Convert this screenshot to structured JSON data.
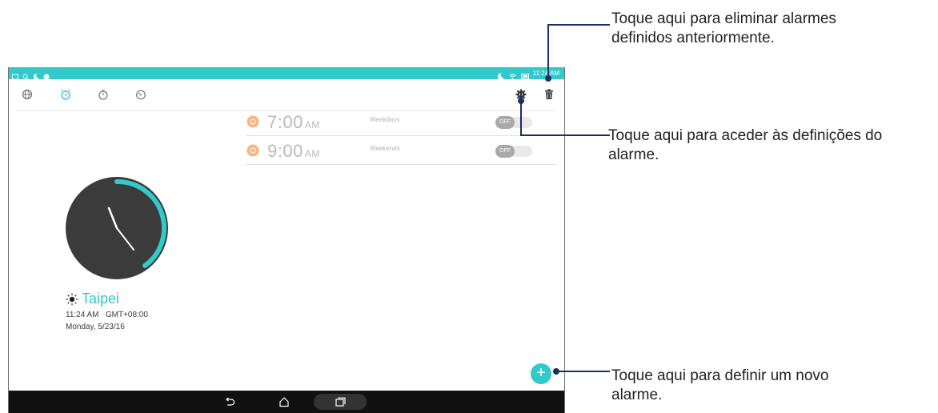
{
  "status_bar": {
    "time": "11:24 AM"
  },
  "tabs": [
    {
      "name": "world-clock",
      "icon": "globe-icon"
    },
    {
      "name": "alarm",
      "icon": "alarm-clock-icon",
      "active": true
    },
    {
      "name": "stopwatch",
      "icon": "stopwatch-icon"
    },
    {
      "name": "timer",
      "icon": "timer-icon"
    }
  ],
  "toolbar": {
    "settings_icon": "gear-icon",
    "delete_icon": "trash-icon"
  },
  "alarms": [
    {
      "time": "7:00",
      "ampm": "AM",
      "repeat": "Weekdays",
      "toggle": "OFF"
    },
    {
      "time": "9:00",
      "ampm": "AM",
      "repeat": "Weekends",
      "toggle": "OFF"
    }
  ],
  "clock": {
    "city": "Taipei",
    "time_line": "11:24 AM   GMT+08:00",
    "date_line": "Monday, 5/23/16"
  },
  "fab": {
    "label": "+"
  },
  "callouts": {
    "delete": [
      "Toque aqui para eliminar alarmes",
      "definidos anteriormente."
    ],
    "settings": [
      "Toque aqui para aceder às definições do",
      "alarme."
    ],
    "add": [
      "Toque aqui para definir um novo",
      "alarme."
    ]
  },
  "colors": {
    "accent": "#31c9c9",
    "leader": "#1c2f63",
    "navbar": "#111111"
  }
}
